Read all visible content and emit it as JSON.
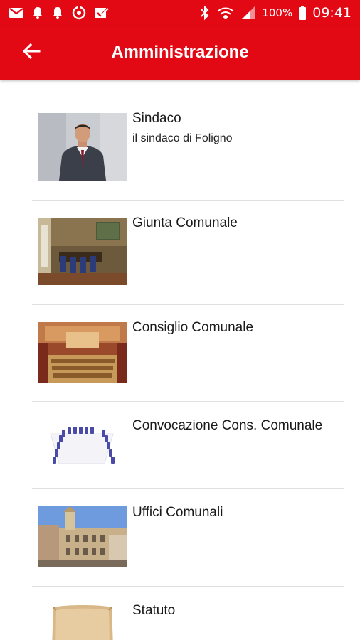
{
  "status_bar": {
    "left_icons": [
      "gmail-icon",
      "bell-icon",
      "bell-icon",
      "sync-icon",
      "checkbox-icon"
    ],
    "battery_percent": "100%",
    "time": "09:41"
  },
  "app_bar": {
    "title": "Amministrazione",
    "back_icon": "arrow-left-icon",
    "color": "#e30914"
  },
  "items": [
    {
      "title": "Sindaco",
      "subtitle": "il sindaco di Foligno",
      "image": "mayor-photo"
    },
    {
      "title": "Giunta Comunale",
      "subtitle": "",
      "image": "council-room-photo"
    },
    {
      "title": "Consiglio Comunale",
      "subtitle": "",
      "image": "council-hall-photo"
    },
    {
      "title": "Convocazione Cons. Comunale",
      "subtitle": "",
      "image": "chairs-illustration"
    },
    {
      "title": "Uffici Comunali",
      "subtitle": "",
      "image": "town-hall-photo"
    },
    {
      "title": "Statuto",
      "subtitle": "",
      "image": "parchment-image"
    }
  ]
}
